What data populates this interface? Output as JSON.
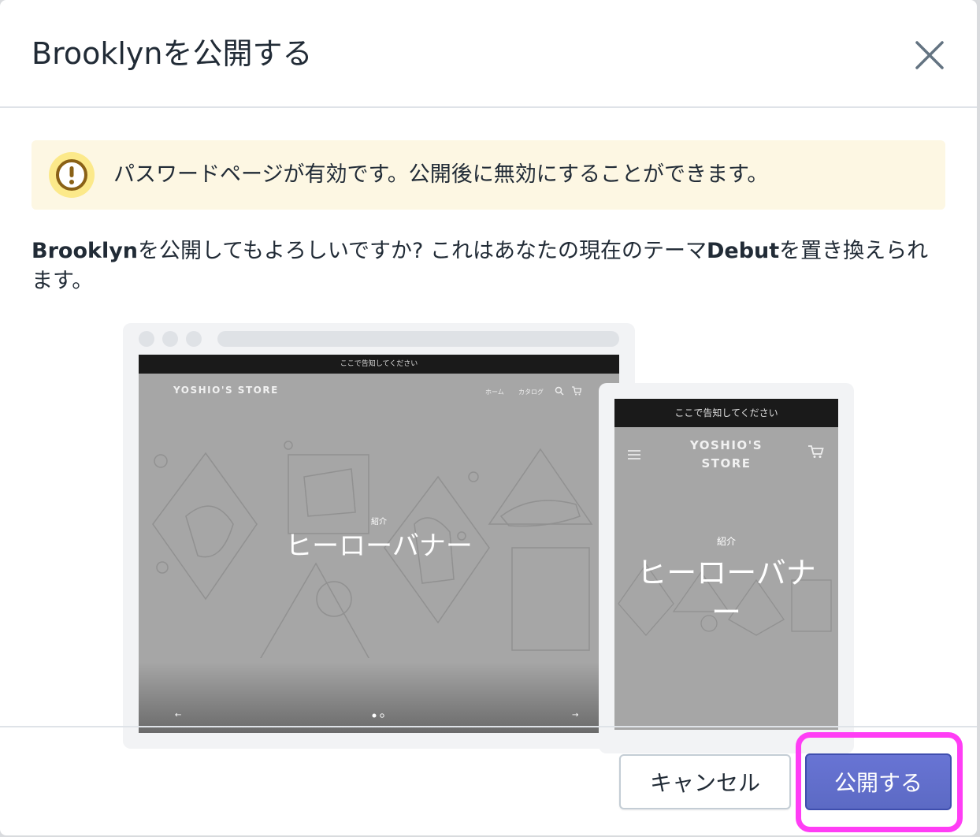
{
  "dialog": {
    "title": "Brooklynを公開する",
    "close_icon": "close-icon"
  },
  "banner": {
    "icon": "warning-icon",
    "text": "パスワードページが有効です。公開後に無効にすることができます。",
    "background": "#fdf7e3",
    "icon_color": "#8a6116"
  },
  "message": {
    "new_theme": "Brooklyn",
    "part1": "を公開してもよろしいですか? これはあなたの現在のテーマ",
    "current_theme": "Debut",
    "part2": "を置き換えられます。"
  },
  "preview": {
    "desktop": {
      "announcement": "ここで告知してください",
      "store_name": "YOSHIO'S STORE",
      "nav": [
        "ホーム",
        "カタログ"
      ],
      "kicker": "紹介",
      "hero_title": "ヒーローバナー",
      "prev_arrow": "←",
      "next_arrow": "→"
    },
    "mobile": {
      "announcement": "ここで告知してください",
      "store_name_line1": "YOSHIO'S",
      "store_name_line2": "STORE",
      "kicker": "紹介",
      "hero_title": "ヒーローバナー"
    }
  },
  "footer": {
    "cancel_label": "キャンセル",
    "publish_label": "公開する",
    "publish_color": "#5c6ac4",
    "highlight_color": "#ff3df5"
  }
}
